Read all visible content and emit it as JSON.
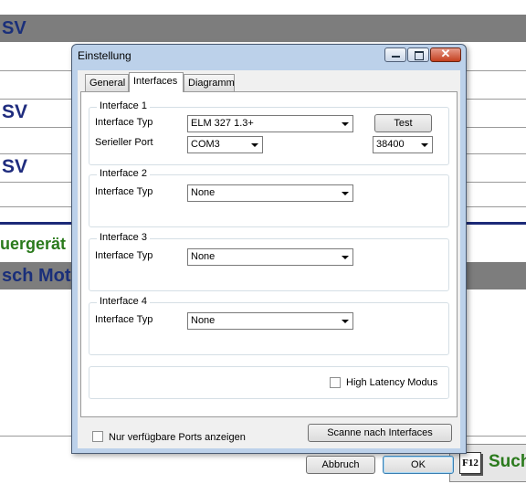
{
  "background": {
    "row1_text": "SV",
    "row2_text": "SV",
    "row3_text": "SV",
    "green_text": "uergerät",
    "grey_text": "sch Mot",
    "f12_key": "F12",
    "f12_label": "Such"
  },
  "dialog": {
    "title": "Einstellung",
    "tabs": [
      "General",
      "Interfaces",
      "Diagramm"
    ],
    "interface1": {
      "group_title": "Interface 1",
      "typ_label": "Interface Typ",
      "typ_value": "ELM 327 1.3+",
      "test_button": "Test",
      "port_label": "Serieller Port",
      "port_value": "COM3",
      "baud_value": "38400"
    },
    "interface2": {
      "group_title": "Interface 2",
      "typ_label": "Interface Typ",
      "typ_value": "None"
    },
    "interface3": {
      "group_title": "Interface 3",
      "typ_label": "Interface Typ",
      "typ_value": "None"
    },
    "interface4": {
      "group_title": "Interface 4",
      "typ_label": "Interface Typ",
      "typ_value": "None"
    },
    "high_latency_label": "High Latency Modus",
    "available_ports_label": "Nur verfügbare Ports anzeigen",
    "scan_button": "Scanne nach Interfaces",
    "cancel_button": "Abbruch",
    "ok_button": "OK"
  }
}
